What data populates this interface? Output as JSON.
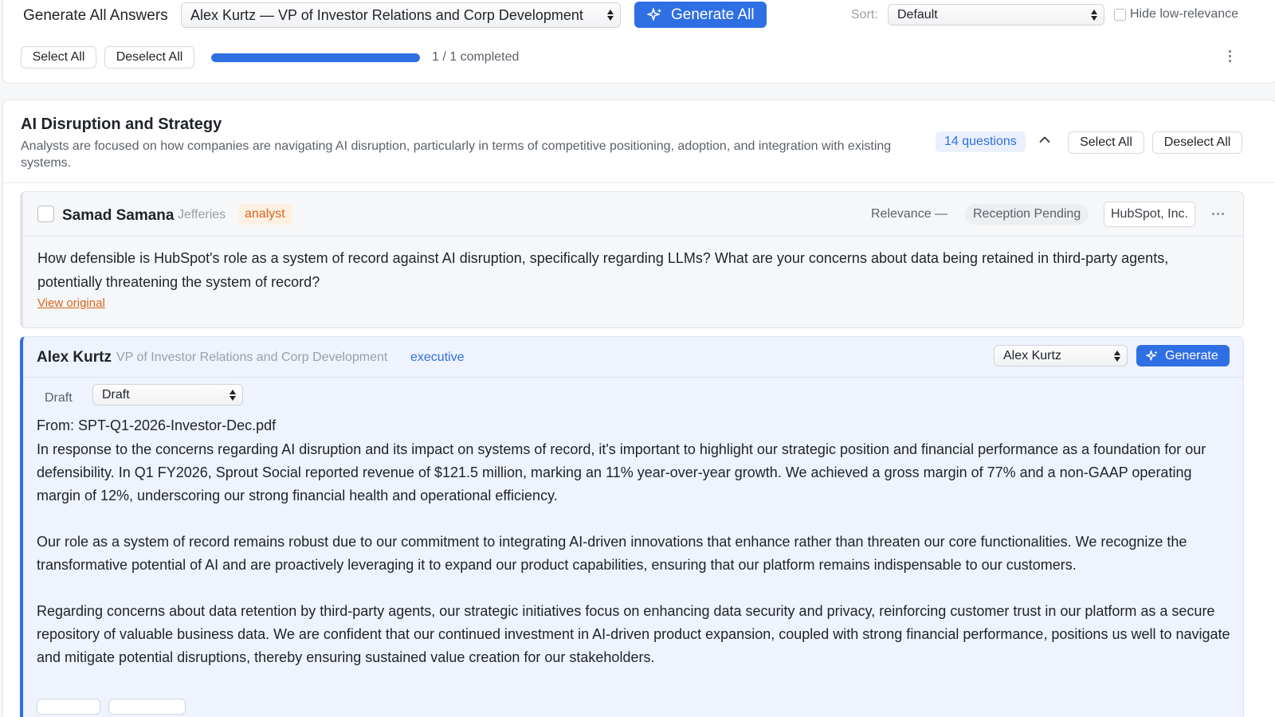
{
  "toolbar": {
    "title": "Generate All Answers",
    "responder_select": "Alex Kurtz — VP of Investor Relations and Corp Development",
    "generate_all_label": "Generate All",
    "sort_label": "Sort:",
    "sort_value": "Default",
    "hide_low_relevance_label": "Hide low-relevance",
    "select_all_label": "Select All",
    "deselect_all_label": "Deselect All",
    "progress_fraction": 1.0,
    "progress_text": "1 / 1 completed",
    "accent_color": "#2f6fe4"
  },
  "section": {
    "title": "AI Disruption and Strategy",
    "description": "Analysts are focused on how companies are navigating AI disruption, particularly in terms of competitive positioning, adoption, and integration with existing systems.",
    "question_count": "14 questions",
    "select_all_label": "Select All",
    "deselect_all_label": "Deselect All"
  },
  "question": {
    "name": "Samad Samana",
    "firm": "Jefferies",
    "role_tag": "analyst",
    "relevance": "Relevance —",
    "reception": "Reception Pending",
    "company": "HubSpot, Inc.",
    "text": "How defensible is HubSpot's role as a system of record against AI disruption, specifically regarding LLMs? What are your concerns about data being retained in third-party agents, potentially threatening the system of record?",
    "link": "View original"
  },
  "answer": {
    "name": "Alex Kurtz",
    "role": "VP of Investor Relations and Corp Development",
    "role_tag": "executive",
    "speaker_select": "Alex Kurtz",
    "generate_label": "Generate",
    "status_label": "Draft",
    "status_select": "Draft",
    "source": "From: SPT-Q1-2026-Investor-Dec.pdf",
    "paragraphs": [
      "In response to the concerns regarding AI disruption and its impact on systems of record, it's important to highlight our strategic position and financial performance as a foundation for our defensibility. In Q1 FY2026, Sprout Social reported revenue of $121.5 million, marking an 11% year-over-year growth. We achieved a gross margin of 77% and a non-GAAP operating margin of 12%, underscoring our strong financial health and operational efficiency.",
      "Our role as a system of record remains robust due to our commitment to integrating AI-driven innovations that enhance rather than threaten our core functionalities. We recognize the transformative potential of AI and are proactively leveraging it to expand our product capabilities, ensuring that our platform remains indispensable to our customers.",
      "Regarding concerns about data retention by third-party agents, our strategic initiatives focus on enhancing data security and privacy, reinforcing customer trust in our platform as a secure repository of valuable business data. We are confident that our continued investment in AI-driven product expansion, coupled with strong financial performance, positions us well to navigate and mitigate potential disruptions, thereby ensuring sustained value creation for our stakeholders."
    ]
  }
}
